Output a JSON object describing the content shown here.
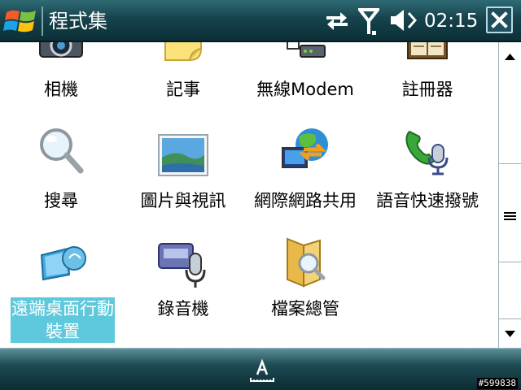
{
  "window": {
    "title": "程式集",
    "clock": "02:15"
  },
  "status_icons": [
    "connectivity-arrows-icon",
    "signal-antenna-icon",
    "volume-speaker-icon"
  ],
  "programs": [
    {
      "label": "相機",
      "icon": "camera-icon",
      "selected": false
    },
    {
      "label": "記事",
      "icon": "notes-icon",
      "selected": false
    },
    {
      "label": "無線Modem",
      "icon": "wireless-modem-icon",
      "selected": false
    },
    {
      "label": "註冊器",
      "icon": "registry-book-icon",
      "selected": false
    },
    {
      "label": "搜尋",
      "icon": "magnifier-icon",
      "selected": false
    },
    {
      "label": "圖片與視訊",
      "icon": "picture-icon",
      "selected": false
    },
    {
      "label": "網際網路共用",
      "icon": "internet-sharing-icon",
      "selected": false
    },
    {
      "label": "語音快速撥號",
      "icon": "voice-dial-icon",
      "selected": false
    },
    {
      "label": "遠端桌面行動裝置",
      "icon": "remote-desktop-icon",
      "selected": true
    },
    {
      "label": "錄音機",
      "icon": "voice-recorder-icon",
      "selected": false
    },
    {
      "label": "檔案總管",
      "icon": "file-explorer-icon",
      "selected": false
    }
  ],
  "scrollbar": {
    "position": 0.62
  },
  "bottom_bar": {
    "input_panel_icon": "input-panel-icon"
  },
  "watermark": "#599838",
  "colors": {
    "titlebar": "#16434c",
    "selection": "#5ec9dc",
    "bottombar": "#1d4a53"
  }
}
